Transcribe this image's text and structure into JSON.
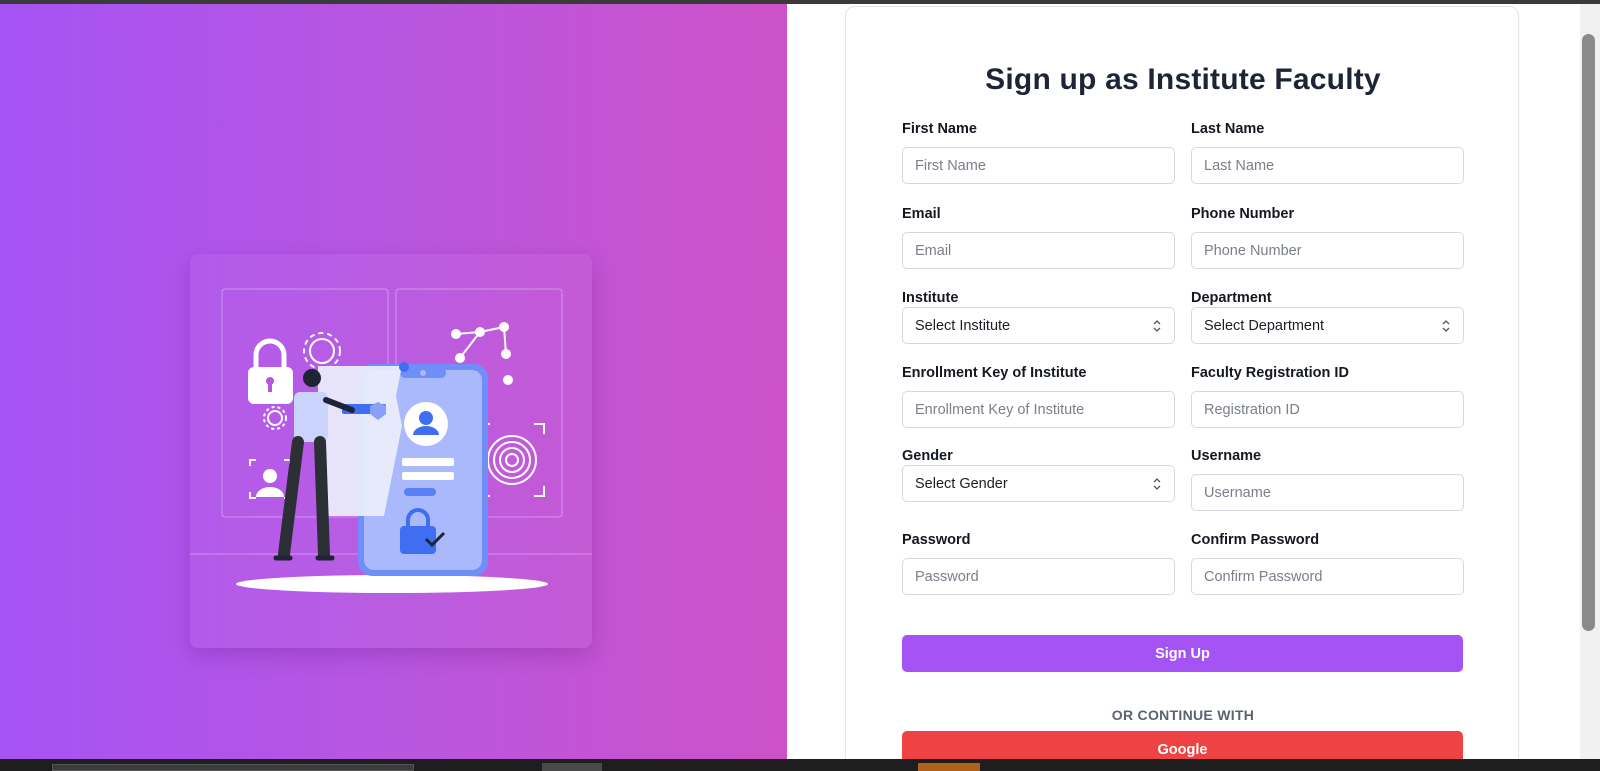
{
  "form": {
    "title": "Sign up as Institute Faculty",
    "first_name": {
      "label": "First Name",
      "placeholder": "First Name"
    },
    "last_name": {
      "label": "Last Name",
      "placeholder": "Last Name"
    },
    "email": {
      "label": "Email",
      "placeholder": "Email"
    },
    "phone": {
      "label": "Phone Number",
      "placeholder": "Phone Number"
    },
    "institute": {
      "label": "Institute",
      "selected": "Select Institute"
    },
    "department": {
      "label": "Department",
      "selected": "Select Department"
    },
    "enrollment_key": {
      "label": "Enrollment Key of Institute",
      "placeholder": "Enrollment Key of Institute"
    },
    "faculty_reg_id": {
      "label": "Faculty Registration ID",
      "placeholder": "Registration ID"
    },
    "gender": {
      "label": "Gender",
      "selected": "Select Gender"
    },
    "username": {
      "label": "Username",
      "placeholder": "Username"
    },
    "password": {
      "label": "Password",
      "placeholder": "Password"
    },
    "confirm_password": {
      "label": "Confirm Password",
      "placeholder": "Confirm Password"
    },
    "signup_label": "Sign Up",
    "or_text": "OR CONTINUE WITH",
    "google_label": "Google"
  },
  "colors": {
    "accent": "#a653f5",
    "google": "#ee4244",
    "gradient_start": "#a653f5",
    "gradient_end": "#cd52c8"
  },
  "illustration": {
    "icons": [
      "padlock-icon",
      "gear-icon",
      "fingerprint-icon",
      "user-icon",
      "network-icon"
    ],
    "subject": "person-at-phone-login"
  }
}
